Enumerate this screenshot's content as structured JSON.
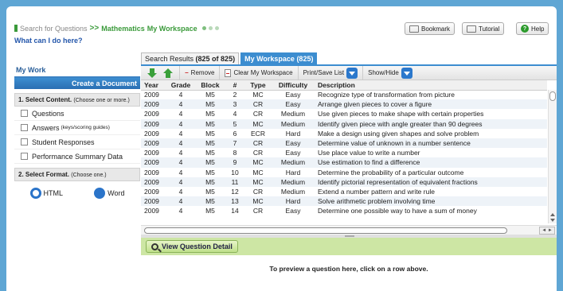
{
  "header": {
    "crumb_search": "Search for Questions",
    "crumb_separator": ">>",
    "crumb_subject": "Mathematics",
    "crumb_page": "My Workspace",
    "bookmark_label": "Bookmark",
    "tutorial_label": "Tutorial",
    "help_label": "Help",
    "what_can_i_do": "What can I do here?"
  },
  "sidebar": {
    "my_work": "My Work",
    "create_doc": "Create a Document",
    "select_content_title": "1. Select Content.",
    "select_content_hint": "(Choose one or more.)",
    "content_options": [
      {
        "label": "Questions",
        "note": ""
      },
      {
        "label": "Answers",
        "note": "(keys/scoring guides)"
      },
      {
        "label": "Student Responses",
        "note": ""
      },
      {
        "label": "Performance Summary Data",
        "note": ""
      }
    ],
    "select_format_title": "2. Select Format.",
    "select_format_hint": "(Choose one.)",
    "format_html": "HTML",
    "format_word": "Word"
  },
  "tabs": {
    "search_results_label": "Search Results",
    "search_results_count": "(825 of 825)",
    "workspace_label": "My Workspace (825)"
  },
  "toolbar": {
    "remove": "Remove",
    "clear": "Clear My Workspace",
    "print_save": "Print/Save List",
    "show_hide": "Show/Hide"
  },
  "table": {
    "columns": [
      "Year",
      "Grade",
      "Block",
      "#",
      "Type",
      "Difficulty",
      "Description"
    ],
    "rows": [
      [
        "2009",
        "4",
        "M5",
        "2",
        "MC",
        "Easy",
        "Recognize type of transformation from picture"
      ],
      [
        "2009",
        "4",
        "M5",
        "3",
        "CR",
        "Easy",
        "Arrange given pieces to cover a figure"
      ],
      [
        "2009",
        "4",
        "M5",
        "4",
        "CR",
        "Medium",
        "Use given pieces to make shape with certain properties"
      ],
      [
        "2009",
        "4",
        "M5",
        "5",
        "MC",
        "Medium",
        "Identify given piece with angle greater than 90 degrees"
      ],
      [
        "2009",
        "4",
        "M5",
        "6",
        "ECR",
        "Hard",
        "Make a design using given shapes and solve problem"
      ],
      [
        "2009",
        "4",
        "M5",
        "7",
        "CR",
        "Easy",
        "Determine value of unknown in a number sentence"
      ],
      [
        "2009",
        "4",
        "M5",
        "8",
        "CR",
        "Easy",
        "Use place value to write a number"
      ],
      [
        "2009",
        "4",
        "M5",
        "9",
        "MC",
        "Medium",
        "Use estimation to find a difference"
      ],
      [
        "2009",
        "4",
        "M5",
        "10",
        "MC",
        "Hard",
        "Determine the probability of a particular outcome"
      ],
      [
        "2009",
        "4",
        "M5",
        "11",
        "MC",
        "Medium",
        "Identify pictorial representation of equivalent fractions"
      ],
      [
        "2009",
        "4",
        "M5",
        "12",
        "CR",
        "Medium",
        "Extend a number pattern and write rule"
      ],
      [
        "2009",
        "4",
        "M5",
        "13",
        "MC",
        "Hard",
        "Solve arithmetic problem involving time"
      ],
      [
        "2009",
        "4",
        "M5",
        "14",
        "CR",
        "Easy",
        "Determine one possible way to have a sum of money"
      ]
    ]
  },
  "detail": {
    "view_button": "View Question Detail",
    "preview_text": "To preview a question here, click on a row above."
  }
}
